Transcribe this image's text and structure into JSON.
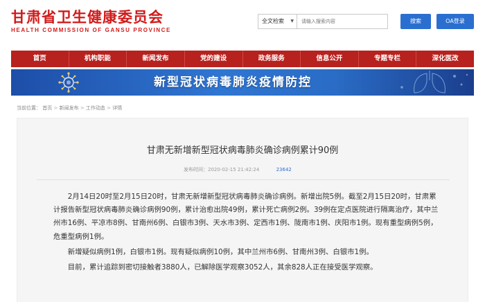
{
  "header": {
    "logo_cn": "甘肃省卫生健康委员会",
    "logo_en": "HEALTH COMMISSION OF GANSU PROVINCE",
    "search_scope": "全文检索",
    "search_placeholder": "请输入搜索内容",
    "search_button": "搜索",
    "oa_button": "OA登录"
  },
  "nav": {
    "items": [
      "首页",
      "机构职能",
      "新闻发布",
      "党的建设",
      "政务服务",
      "信息公开",
      "专题专栏",
      "深化医改"
    ]
  },
  "banner": {
    "title": "新型冠状病毒肺炎疫情防控"
  },
  "breadcrumb": {
    "label": "当前位置：",
    "items": [
      "首页",
      "新闻发布",
      "工作动态",
      "详情"
    ],
    "separator": ">"
  },
  "article": {
    "title": "甘肃无新增新型冠状病毒肺炎确诊病例累计90例",
    "published": "发布时间：2020-02-15 21:42:24",
    "views": "23642",
    "paragraphs": [
      "2月14日20时至2月15日20时，甘肃无新增新型冠状病毒肺炎确诊病例。新增出院5例。截至2月15日20时，甘肃累计报告新型冠状病毒肺炎确诊病例90例，累计治愈出院49例，累计死亡病例2例。39例在定点医院进行隔离治疗，其中兰州市16例、平凉市8例、甘南州6例、白银市3例、天水市3例、定西市1例、陇南市1例、庆阳市1例。现有重型病例5例，危重型病例1例。",
      "新增疑似病例1例，白银市1例。现有疑似病例10例，其中兰州市6例、甘南州3例、白银市1例。",
      "目前，累计追踪到密切接触者3880人，已解除医学观察3052人，其余828人正在接受医学观察。"
    ]
  },
  "colors": {
    "brand_red": "#d11a1a",
    "nav_red": "#b7211e",
    "button_blue": "#2a6fd0"
  }
}
